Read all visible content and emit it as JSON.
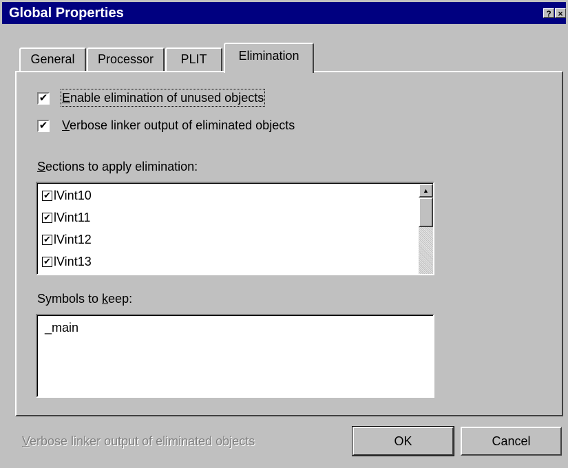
{
  "window": {
    "title": "Global Properties",
    "help_glyph": "?",
    "close_glyph": "×"
  },
  "tabs": [
    {
      "label": "General"
    },
    {
      "label": "Processor"
    },
    {
      "label": "PLIT"
    },
    {
      "label": "Elimination",
      "active": true
    }
  ],
  "options": {
    "enable_elimination": {
      "accel": "E",
      "rest": "nable elimination of unused objects",
      "checked": true
    },
    "verbose_output": {
      "accel": "V",
      "rest": "erbose linker output of eliminated objects",
      "checked": true
    }
  },
  "sections": {
    "label_accel": "S",
    "label_rest": "ections to apply elimination:",
    "items": [
      {
        "label": "lVint10",
        "checked": true
      },
      {
        "label": "lVint11",
        "checked": true
      },
      {
        "label": "lVint12",
        "checked": true
      },
      {
        "label": "lVint13",
        "checked": true
      }
    ],
    "scroll_up_glyph": "▲"
  },
  "symbols": {
    "label_pre": "Symbols to ",
    "label_accel": "k",
    "label_post": "eep:",
    "value": "_main"
  },
  "footer": {
    "status_accel": "V",
    "status_rest": "erbose linker output of eliminated objects",
    "ok_label": "OK",
    "cancel_label": "Cancel"
  },
  "glyphs": {
    "check": "✔"
  }
}
